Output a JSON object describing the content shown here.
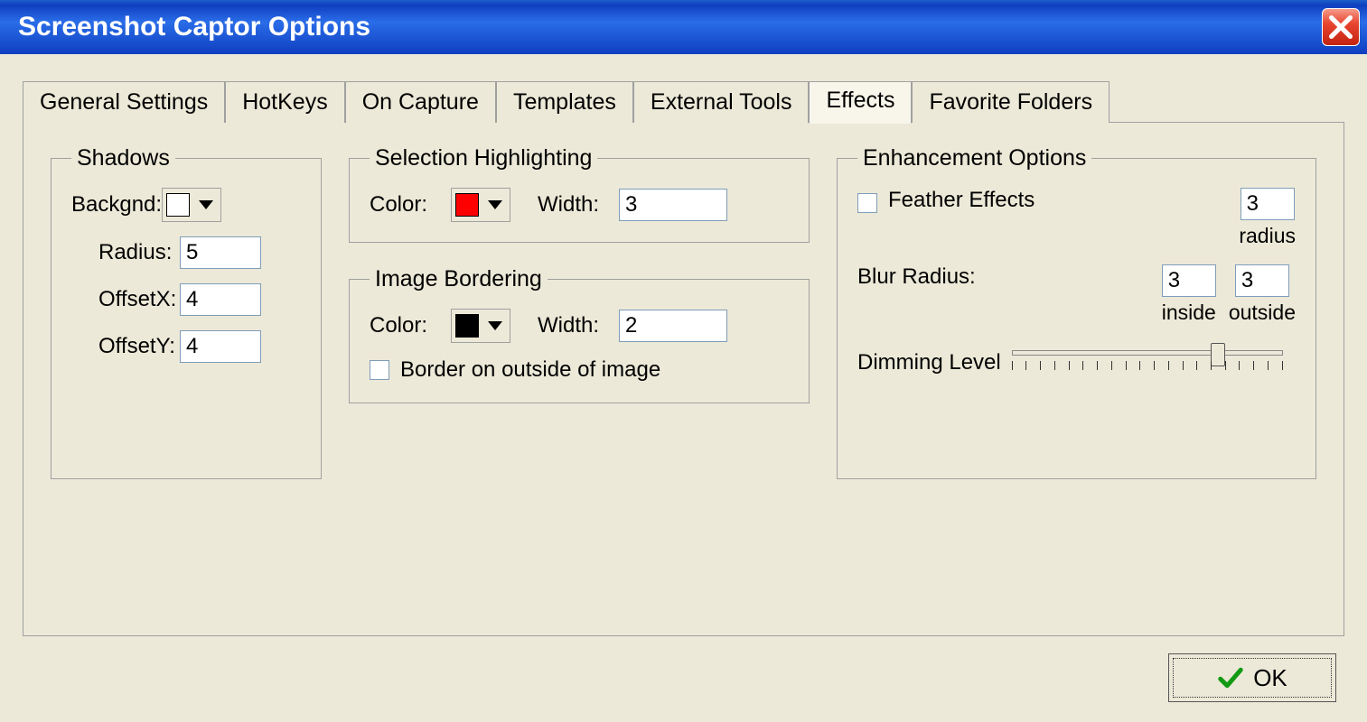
{
  "window": {
    "title": "Screenshot Captor Options"
  },
  "tabs": [
    {
      "label": "General Settings"
    },
    {
      "label": "HotKeys"
    },
    {
      "label": "On Capture"
    },
    {
      "label": "Templates"
    },
    {
      "label": "External Tools"
    },
    {
      "label": "Effects"
    },
    {
      "label": "Favorite Folders"
    }
  ],
  "shadows": {
    "legend": "Shadows",
    "backgnd_label": "Backgnd:",
    "backgnd_color": "#ffffff",
    "radius_label": "Radius:",
    "radius": "5",
    "offsetx_label": "OffsetX:",
    "offsetx": "4",
    "offsety_label": "OffsetY:",
    "offsety": "4"
  },
  "selection": {
    "legend": "Selection Highlighting",
    "color_label": "Color:",
    "color": "#ff0000",
    "width_label": "Width:",
    "width": "3"
  },
  "border": {
    "legend": "Image Bordering",
    "color_label": "Color:",
    "color": "#000000",
    "width_label": "Width:",
    "width": "2",
    "outside_label": "Border on outside of image"
  },
  "enhance": {
    "legend": "Enhancement Options",
    "feather_label": "Feather Effects",
    "feather_value": "3",
    "feather_unit": "radius",
    "blur_label": "Blur Radius:",
    "blur_inside": "3",
    "blur_outside": "3",
    "inside_label": "inside",
    "outside_label": "outside",
    "dimming_label": "Dimming Level"
  },
  "buttons": {
    "ok": "OK"
  }
}
